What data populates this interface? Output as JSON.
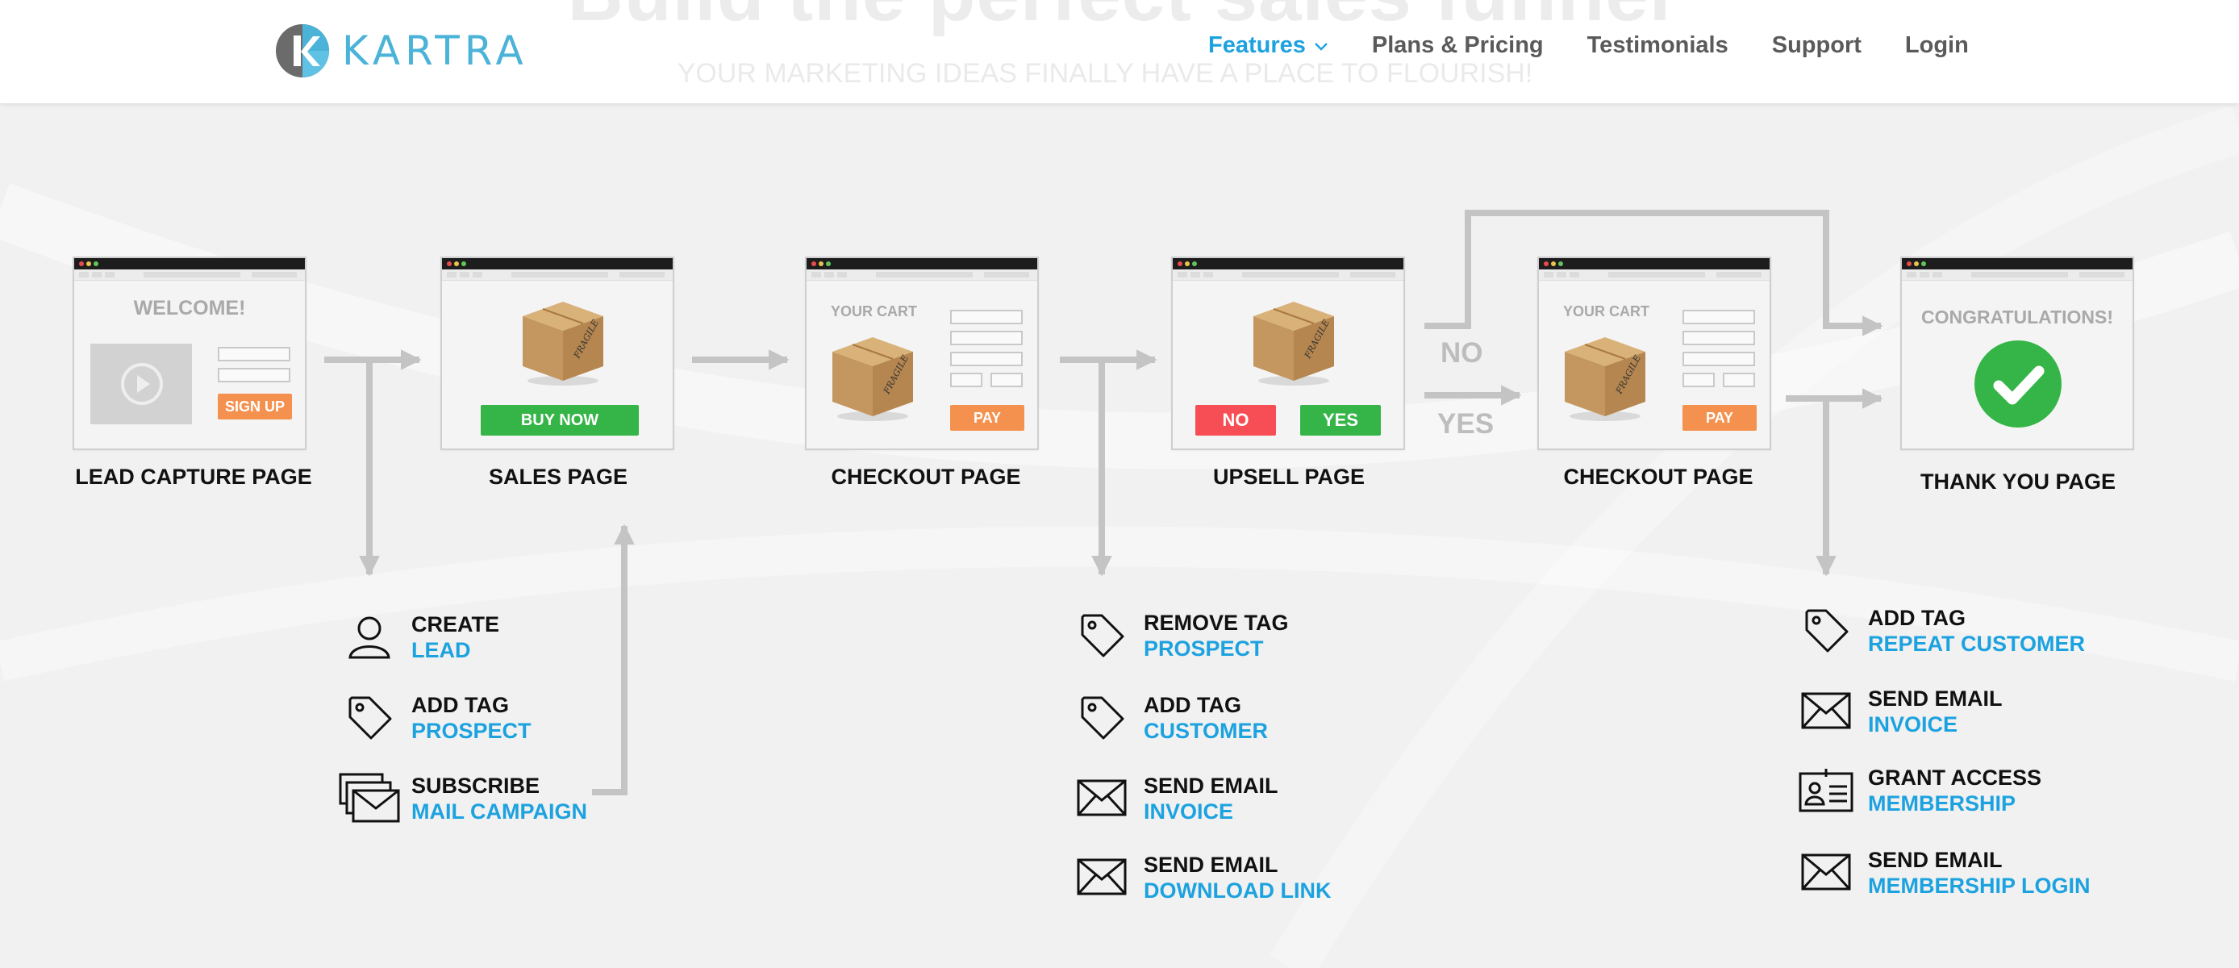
{
  "header": {
    "ghost_title": "Build the perfect sales funnel",
    "ghost_subtitle": "YOUR MARKETING IDEAS FINALLY HAVE A PLACE TO FLOURISH!",
    "logo_text": "KARTRA",
    "nav": [
      {
        "label": "Features",
        "icon": "chevron-down-icon",
        "active": true
      },
      {
        "label": "Plans & Pricing"
      },
      {
        "label": "Testimonials"
      },
      {
        "label": "Support"
      },
      {
        "label": "Login"
      }
    ]
  },
  "funnel": {
    "pages": [
      {
        "label": "LEAD CAPTURE PAGE",
        "heading": "WELCOME!",
        "button": "SIGN UP"
      },
      {
        "label": "SALES PAGE",
        "button": "BUY NOW"
      },
      {
        "label": "CHECKOUT PAGE",
        "heading": "YOUR CART",
        "button": "PAY"
      },
      {
        "label": "UPSELL PAGE",
        "button_no": "NO",
        "button_yes": "YES"
      },
      {
        "label": "CHECKOUT PAGE",
        "heading": "YOUR CART",
        "button": "PAY"
      },
      {
        "label": "THANK YOU PAGE",
        "heading": "CONGRATULATIONS!"
      }
    ],
    "branch_no": "NO",
    "branch_yes": "YES",
    "box_label": "FRAGILE"
  },
  "actions": {
    "group1": [
      {
        "icon": "user-icon",
        "line1": "CREATE",
        "line2": "LEAD"
      },
      {
        "icon": "tag-icon",
        "line1": "ADD TAG",
        "line2": "PROSPECT"
      },
      {
        "icon": "mail-stack-icon",
        "line1": "SUBSCRIBE",
        "line2": "MAIL CAMPAIGN"
      }
    ],
    "group2": [
      {
        "icon": "tag-icon",
        "line1": "REMOVE TAG",
        "line2": "PROSPECT"
      },
      {
        "icon": "tag-icon",
        "line1": "ADD TAG",
        "line2": "CUSTOMER"
      },
      {
        "icon": "envelope-icon",
        "line1": "SEND EMAIL",
        "line2": "INVOICE"
      },
      {
        "icon": "envelope-icon",
        "line1": "SEND EMAIL",
        "line2": "DOWNLOAD LINK"
      }
    ],
    "group3": [
      {
        "icon": "tag-icon",
        "line1": "ADD TAG",
        "line2": "REPEAT CUSTOMER"
      },
      {
        "icon": "envelope-icon",
        "line1": "SEND EMAIL",
        "line2": "INVOICE"
      },
      {
        "icon": "id-card-icon",
        "line1": "GRANT ACCESS",
        "line2": "MEMBERSHIP"
      },
      {
        "icon": "envelope-icon",
        "line1": "SEND EMAIL",
        "line2": "MEMBERSHIP LOGIN"
      }
    ]
  },
  "colors": {
    "accent": "#1da2e0",
    "logo": "#4ab3d7",
    "arrow": "#c4c4c4",
    "green": "#35b547",
    "orange": "#f4914f",
    "red": "#f74d54"
  }
}
